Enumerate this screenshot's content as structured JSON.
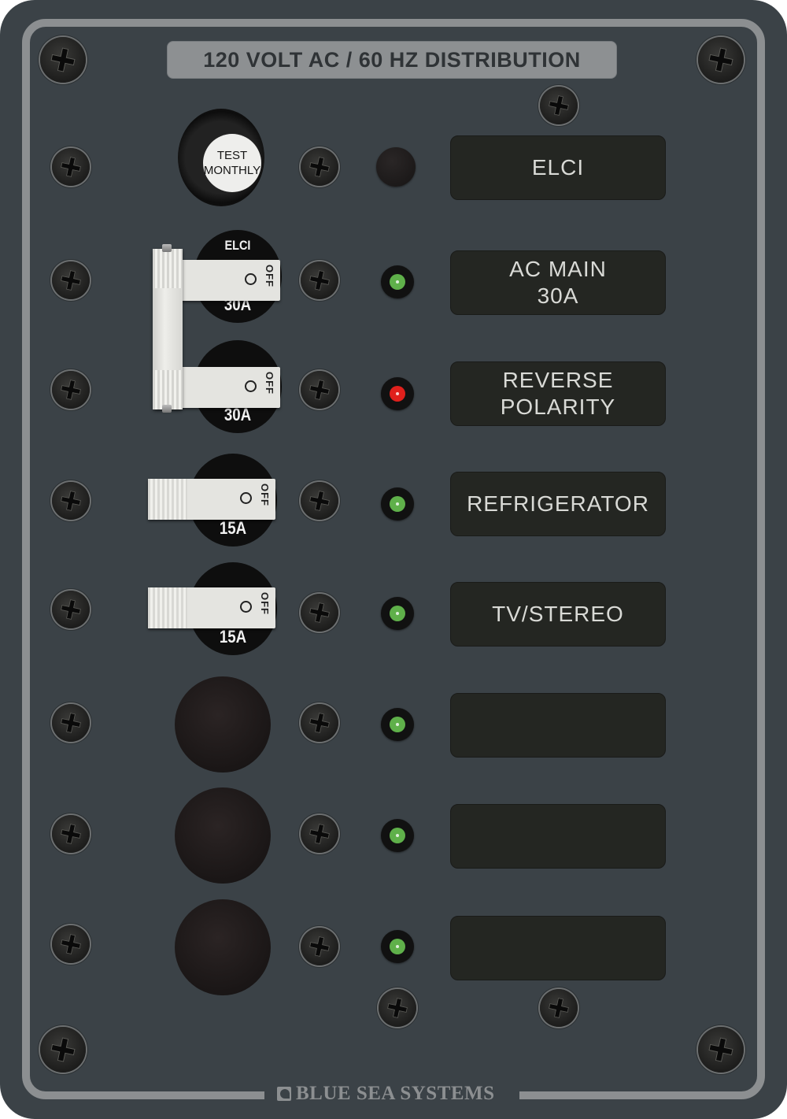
{
  "panel": {
    "title": "120 VOLT AC / 60 HZ DISTRIBUTION",
    "brand": "BLUE SEA SYSTEMS",
    "colors": {
      "panel": "#3b4247",
      "border": "#8c8f91",
      "label_plate": "#242622",
      "led_green": "#5fb04a",
      "led_red": "#e0201c"
    }
  },
  "test_button": {
    "line1": "TEST",
    "line2": "MONTHLY"
  },
  "circuits": [
    {
      "label_line1": "ELCI",
      "label_line2": "",
      "indicator": "none",
      "device": "test-button"
    },
    {
      "label_line1": "AC MAIN",
      "label_line2": "30A",
      "indicator": "green",
      "device": "breaker",
      "breaker_top": "ELCI",
      "rating": "30A",
      "state": "OFF"
    },
    {
      "label_line1": "REVERSE",
      "label_line2": "POLARITY",
      "indicator": "red",
      "device": "breaker",
      "rating": "30A",
      "state": "OFF"
    },
    {
      "label_line1": "REFRIGERATOR",
      "label_line2": "",
      "indicator": "green",
      "device": "breaker",
      "rating": "15A",
      "state": "OFF"
    },
    {
      "label_line1": "TV/STEREO",
      "label_line2": "",
      "indicator": "green",
      "device": "breaker",
      "rating": "15A",
      "state": "OFF"
    },
    {
      "label_line1": "",
      "label_line2": "",
      "indicator": "green",
      "device": "blank"
    },
    {
      "label_line1": "",
      "label_line2": "",
      "indicator": "green",
      "device": "blank"
    },
    {
      "label_line1": "",
      "label_line2": "",
      "indicator": "green",
      "device": "blank"
    }
  ],
  "switch_text": {
    "off": "OFF"
  }
}
